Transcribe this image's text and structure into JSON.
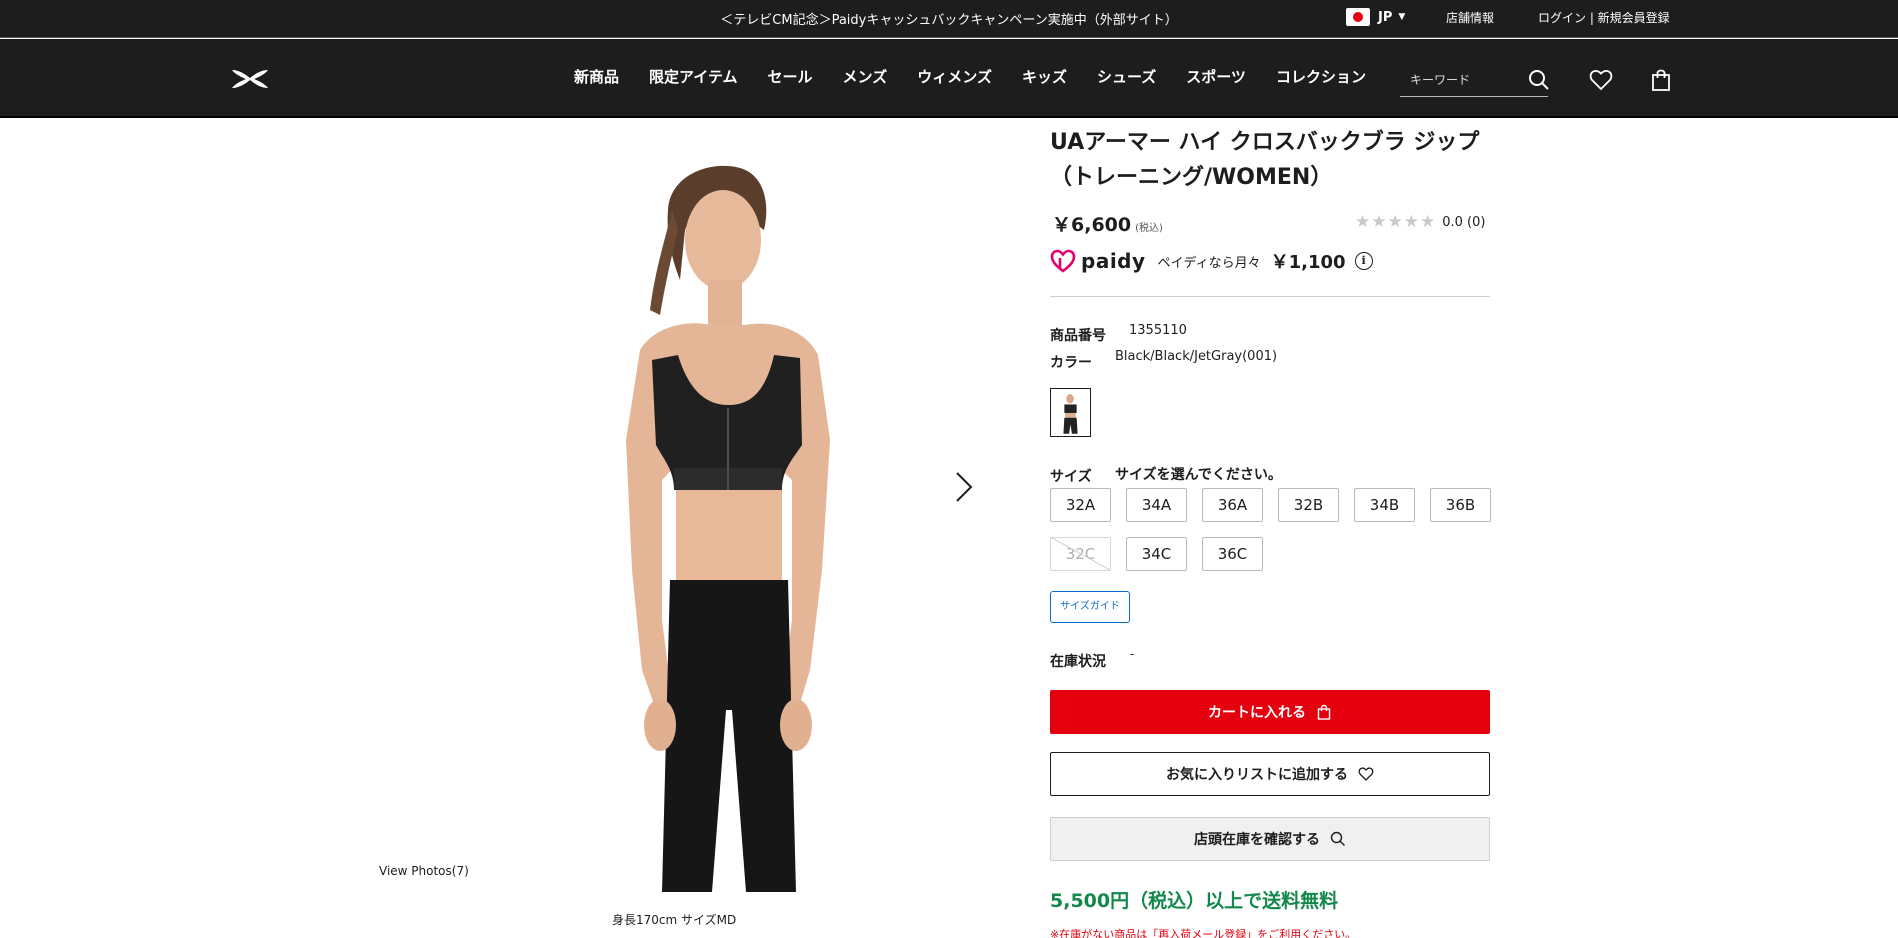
{
  "announcement": {
    "text": "＜テレビCM記念＞Paidyキャッシュバックキャンペーン実施中（外部サイト）"
  },
  "utility": {
    "country": "JP",
    "stores": "店舗情報",
    "login": "ログイン | 新規会員登録"
  },
  "nav": {
    "items": [
      "新商品",
      "限定アイテム",
      "セール",
      "メンズ",
      "ウィメンズ",
      "キッズ",
      "シューズ",
      "スポーツ",
      "コレクション"
    ],
    "search_placeholder": "キーワード"
  },
  "gallery": {
    "view_photos": "View Photos(7)",
    "model_caption": "身長170cm サイズMD"
  },
  "product": {
    "title": "UAアーマー ハイ クロスバックブラ ジップ（トレーニング/WOMEN）",
    "price": "￥6,600",
    "tax_note": "(税込)",
    "rating": {
      "text": "0.0 (0)",
      "stars_filled": 0,
      "stars_total": 5
    },
    "paidy": {
      "brand": "paidy",
      "text": "ペイディなら月々",
      "amount": "￥1,100"
    },
    "number_label": "商品番号",
    "number": "1355110",
    "color_label": "カラー",
    "color": "Black/Black/JetGray(001)",
    "size_label": "サイズ",
    "size_prompt": "サイズを選んでください。",
    "sizes": [
      {
        "label": "32A",
        "available": true
      },
      {
        "label": "34A",
        "available": true
      },
      {
        "label": "36A",
        "available": true
      },
      {
        "label": "32B",
        "available": true
      },
      {
        "label": "34B",
        "available": true
      },
      {
        "label": "36B",
        "available": true
      },
      {
        "label": "32C",
        "available": false
      },
      {
        "label": "34C",
        "available": true
      },
      {
        "label": "36C",
        "available": true
      }
    ],
    "size_guide": "サイズガイド",
    "stock_label": "在庫状況",
    "stock_value": "-",
    "cart_button": "カートに入れる",
    "wishlist_button": "お気に入りリストに追加する",
    "store_stock_button": "店頭在庫を確認する",
    "shipping": "5,500円（税込）以上で送料無料",
    "notice": "※在庫がない商品は「再入荷メール登録」をご利用ください。"
  },
  "colors": {
    "header_bg": "#1d1d1d",
    "cart_red": "#e4000f",
    "shipping_green": "#12884a",
    "guide_blue": "#0b6bcb",
    "paidy_pink": "#e5006e"
  },
  "icons": [
    "japan-flag-icon",
    "caret-down-icon",
    "under-armour-logo",
    "search-icon",
    "heart-icon",
    "bag-icon",
    "chevron-right-icon",
    "info-icon",
    "star-icon",
    "paidy-logo-icon"
  ]
}
